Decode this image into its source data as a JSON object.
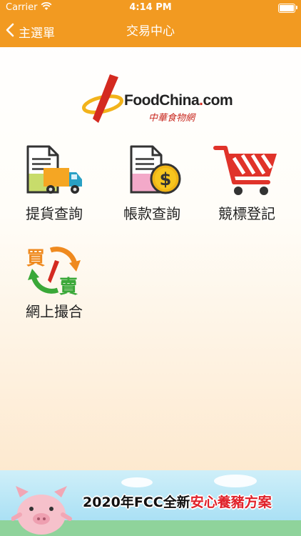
{
  "status_bar": {
    "carrier": "Carrier",
    "time": "4:14 PM"
  },
  "nav": {
    "back_label": "主選單",
    "title": "交易中心"
  },
  "logo": {
    "brand": "FoodChina",
    "brand_dot": ".",
    "brand_suffix": "com",
    "chinese": "中華食物網"
  },
  "menu": {
    "items": [
      {
        "label": "提貨查詢",
        "icon": "document-truck-icon"
      },
      {
        "label": "帳款查詢",
        "icon": "document-dollar-icon"
      },
      {
        "label": "競標登記",
        "icon": "shopping-cart-icon"
      },
      {
        "label": "網上撮合",
        "icon": "buy-sell-exchange-icon"
      }
    ]
  },
  "exchange_icon": {
    "buy": "買",
    "sell": "賣"
  },
  "banner": {
    "text_prefix": "2020年FCC全新",
    "text_highlight": "安心養豬方案"
  },
  "colors": {
    "accent": "#f29a21",
    "brand_red": "#d42a20"
  }
}
